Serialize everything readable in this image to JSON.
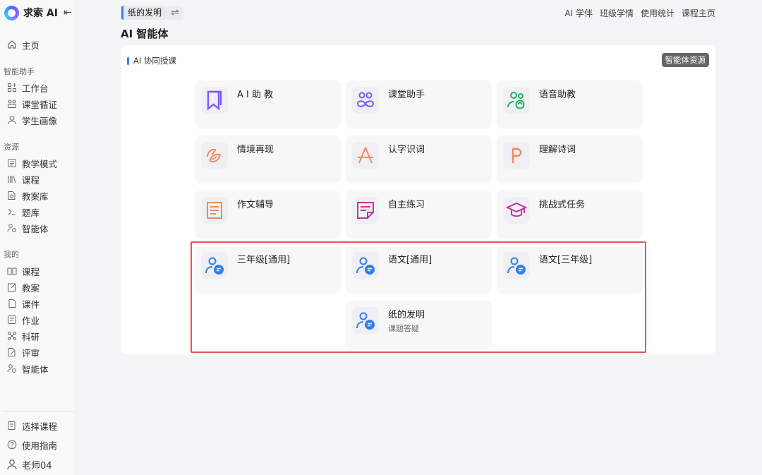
{
  "app": {
    "name": "求索 AI"
  },
  "sidebar": {
    "home": "主页",
    "sections": [
      {
        "label": "智能助手",
        "items": [
          "工作台",
          "课堂循证",
          "学生画像"
        ]
      },
      {
        "label": "资源",
        "items": [
          "教学模式",
          "课程",
          "教案库",
          "题库",
          "智能体"
        ]
      },
      {
        "label": "我的",
        "items": [
          "课程",
          "教案",
          "课件",
          "作业",
          "科研",
          "评审",
          "智能体"
        ]
      }
    ],
    "bottom": {
      "select_course": "选择课程",
      "guide": "使用指南",
      "user": "老师04"
    }
  },
  "topbar": {
    "course_tag": "纸的发明",
    "links": [
      "AI 学伴",
      "班级学情",
      "使用统计",
      "课程主页"
    ]
  },
  "page": {
    "title": "AI 智能体"
  },
  "panel": {
    "heading": "AI 协同授课",
    "resource_button": "智能体资源",
    "cards": [
      {
        "title": "A I 助 教",
        "icon": "bookmark-icon",
        "color": "#7a5af8"
      },
      {
        "title": "课堂助手",
        "icon": "infinity-people-icon",
        "color": "#7a5af8"
      },
      {
        "title": "语音助教",
        "icon": "users-voice-icon",
        "color": "#22b35e"
      },
      {
        "title": "情境再现",
        "icon": "leaf-icon",
        "color": "#f08a5d"
      },
      {
        "title": "认字识词",
        "icon": "letter-a-icon",
        "color": "#f08a5d"
      },
      {
        "title": "理解诗词",
        "icon": "letter-p-icon",
        "color": "#f08a5d"
      },
      {
        "title": "作文辅导",
        "icon": "document-icon",
        "color": "#f08a5d"
      },
      {
        "title": "自主练习",
        "icon": "note-icon",
        "color": "#c0359e"
      },
      {
        "title": "挑战式任务",
        "icon": "graduation-cap-icon",
        "color": "#c0359e"
      },
      {
        "title": "三年级[通用]",
        "icon": "user-chat-icon",
        "color": "#2f80ed"
      },
      {
        "title": "语文[通用]",
        "icon": "user-chat-icon",
        "color": "#2f80ed"
      },
      {
        "title": "语文[三年级]",
        "icon": "user-chat-icon",
        "color": "#2f80ed"
      },
      {
        "title": "纸的发明",
        "subtitle": "课题答疑",
        "icon": "user-chat-icon",
        "color": "#2f80ed"
      }
    ]
  }
}
